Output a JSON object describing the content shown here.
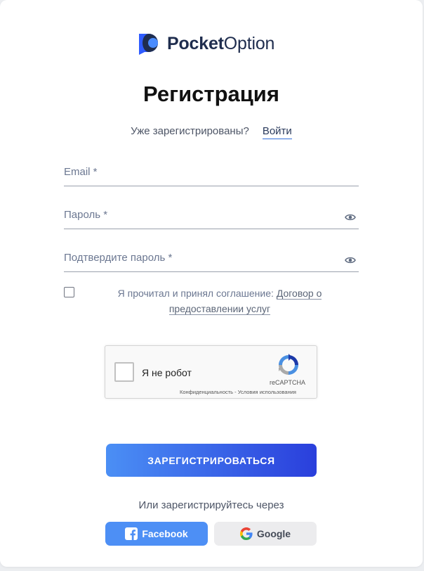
{
  "brand": {
    "name_part1": "Pocket",
    "name_part2": "Option",
    "logo_color": "#2f5cff",
    "logo_dark": "#1f2d4e"
  },
  "page": {
    "title": "Регистрация"
  },
  "login_prompt": {
    "text": "Уже зарегистрированы?",
    "link": "Войти"
  },
  "form": {
    "email_placeholder": "Email *",
    "password_placeholder": "Пароль *",
    "confirm_placeholder": "Подтвердите пароль *",
    "password_icon": "eye-icon",
    "agree_text": "Я прочитал и принял соглашение:",
    "agree_link": "Договор о предоставлении услуг",
    "agree_checked": false
  },
  "recaptcha": {
    "label": "Я не робот",
    "brand": "reCAPTCHA",
    "links": "Конфиденциальность - Условия использования"
  },
  "submit_label": "ЗАРЕГИСТРИРОВАТЬСЯ",
  "submit_colors": {
    "from": "#4b8ff5",
    "to": "#2a3fdc"
  },
  "social": {
    "or_text": "Или зарегистрируйтесь через",
    "facebook_label": "Facebook",
    "google_label": "Google"
  }
}
